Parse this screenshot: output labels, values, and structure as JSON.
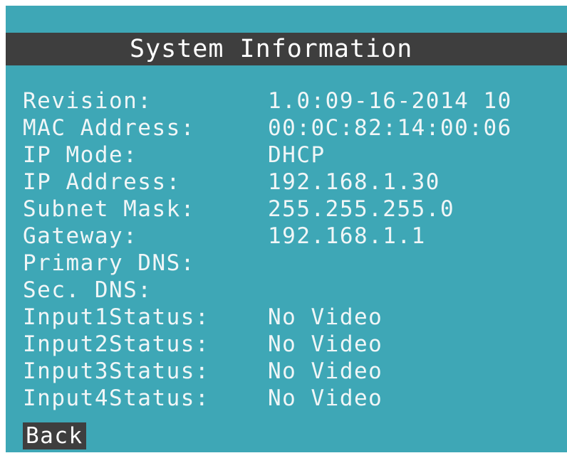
{
  "colors": {
    "background": "#3ea7b6",
    "title_bar": "#3e3e3e",
    "text": "#f0f6f7",
    "back_highlight": "#3e3e3e"
  },
  "title": "System Information",
  "rows": [
    {
      "label": "Revision:",
      "value": "1.0:09-16-2014 10"
    },
    {
      "label": "MAC Address:",
      "value": "00:0C:82:14:00:06"
    },
    {
      "label": "IP Mode:",
      "value": "DHCP"
    },
    {
      "label": "IP Address:",
      "value": "192.168.1.30"
    },
    {
      "label": "Subnet Mask:",
      "value": "255.255.255.0"
    },
    {
      "label": "Gateway:",
      "value": "192.168.1.1"
    },
    {
      "label": "Primary DNS:",
      "value": ""
    },
    {
      "label": "Sec. DNS:",
      "value": ""
    },
    {
      "label": "Input1Status:",
      "value": "No Video"
    },
    {
      "label": "Input2Status:",
      "value": "No Video"
    },
    {
      "label": "Input3Status:",
      "value": "No Video"
    },
    {
      "label": "Input4Status:",
      "value": "No Video"
    }
  ],
  "back_label": "Back"
}
